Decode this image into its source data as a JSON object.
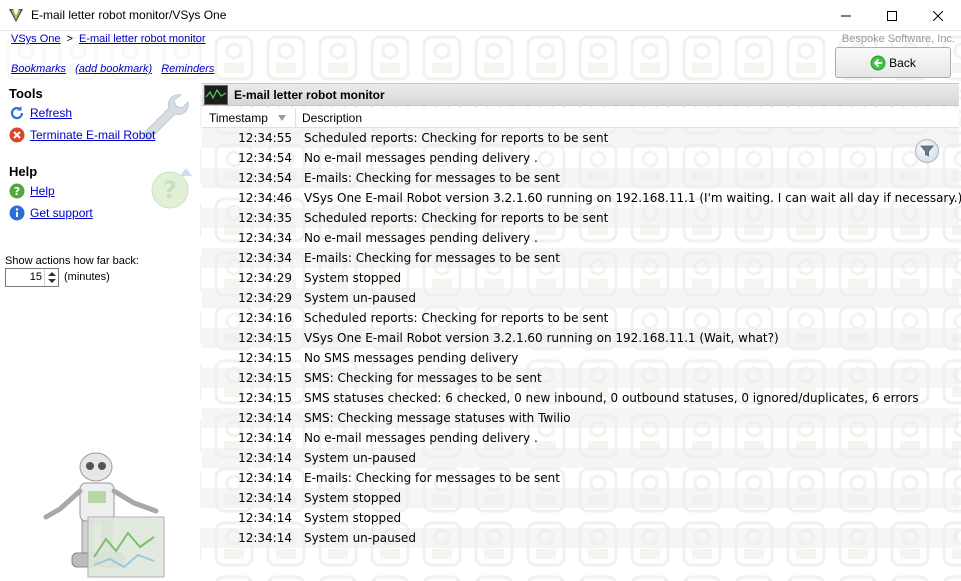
{
  "window": {
    "title": "E-mail letter robot monitor/VSys One",
    "minimize_glyph": "—",
    "maximize_glyph": "☐",
    "close_glyph": "✕"
  },
  "breadcrumb": {
    "root": "VSys One",
    "separator": ">",
    "current": "E-mail letter robot monitor"
  },
  "company": "Bespoke Software, Inc.",
  "links": {
    "bookmarks": "Bookmarks",
    "add_bookmark": "(add bookmark)",
    "reminders": "Reminders"
  },
  "back_button": {
    "label": "Back"
  },
  "tools": {
    "heading": "Tools",
    "refresh": "Refresh",
    "terminate": "Terminate E-mail Robot"
  },
  "help": {
    "heading": "Help",
    "help": "Help",
    "support": "Get support"
  },
  "show_actions": {
    "label": "Show actions how far back:",
    "value": "15",
    "unit": "(minutes)"
  },
  "panel": {
    "title": "E-mail letter robot monitor",
    "col_timestamp": "Timestamp",
    "col_description": "Description"
  },
  "log": [
    {
      "ts": "12:34:55",
      "desc": "Scheduled reports: Checking for reports to be sent"
    },
    {
      "ts": "12:34:54",
      "desc": "No e-mail messages pending delivery ."
    },
    {
      "ts": "12:34:54",
      "desc": "E-mails: Checking for messages to be sent"
    },
    {
      "ts": "12:34:46",
      "desc": "VSys One E-mail Robot version 3.2.1.60 running on 192.168.11.1 (I'm waiting. I can wait all day if necessary.)"
    },
    {
      "ts": "12:34:35",
      "desc": "Scheduled reports: Checking for reports to be sent"
    },
    {
      "ts": "12:34:34",
      "desc": "No e-mail messages pending delivery ."
    },
    {
      "ts": "12:34:34",
      "desc": "E-mails: Checking for messages to be sent"
    },
    {
      "ts": "12:34:29",
      "desc": "System stopped"
    },
    {
      "ts": "12:34:29",
      "desc": "System un-paused"
    },
    {
      "ts": "12:34:16",
      "desc": "Scheduled reports: Checking for reports to be sent"
    },
    {
      "ts": "12:34:15",
      "desc": "VSys One E-mail Robot version 3.2.1.60 running on 192.168.11.1 (Wait, what?)"
    },
    {
      "ts": "12:34:15",
      "desc": "No SMS messages pending delivery"
    },
    {
      "ts": "12:34:15",
      "desc": "SMS: Checking for messages to be sent"
    },
    {
      "ts": "12:34:15",
      "desc": "SMS statuses checked: 6 checked, 0 new inbound, 0 outbound statuses, 0 ignored/duplicates, 6 errors"
    },
    {
      "ts": "12:34:14",
      "desc": "SMS: Checking message statuses with Twilio"
    },
    {
      "ts": "12:34:14",
      "desc": "No e-mail messages pending delivery ."
    },
    {
      "ts": "12:34:14",
      "desc": "System un-paused"
    },
    {
      "ts": "12:34:14",
      "desc": "E-mails: Checking for messages to be sent"
    },
    {
      "ts": "12:34:14",
      "desc": "System stopped"
    },
    {
      "ts": "12:34:14",
      "desc": "System stopped"
    },
    {
      "ts": "12:34:14",
      "desc": "System un-paused"
    }
  ],
  "icons": {
    "app": "vsys-logo-icon",
    "refresh": "refresh-icon",
    "terminate": "stop-icon",
    "help": "question-icon",
    "support": "info-icon",
    "back": "back-arrow-icon",
    "filter": "filter-icon",
    "monitor": "monitor-icon"
  }
}
